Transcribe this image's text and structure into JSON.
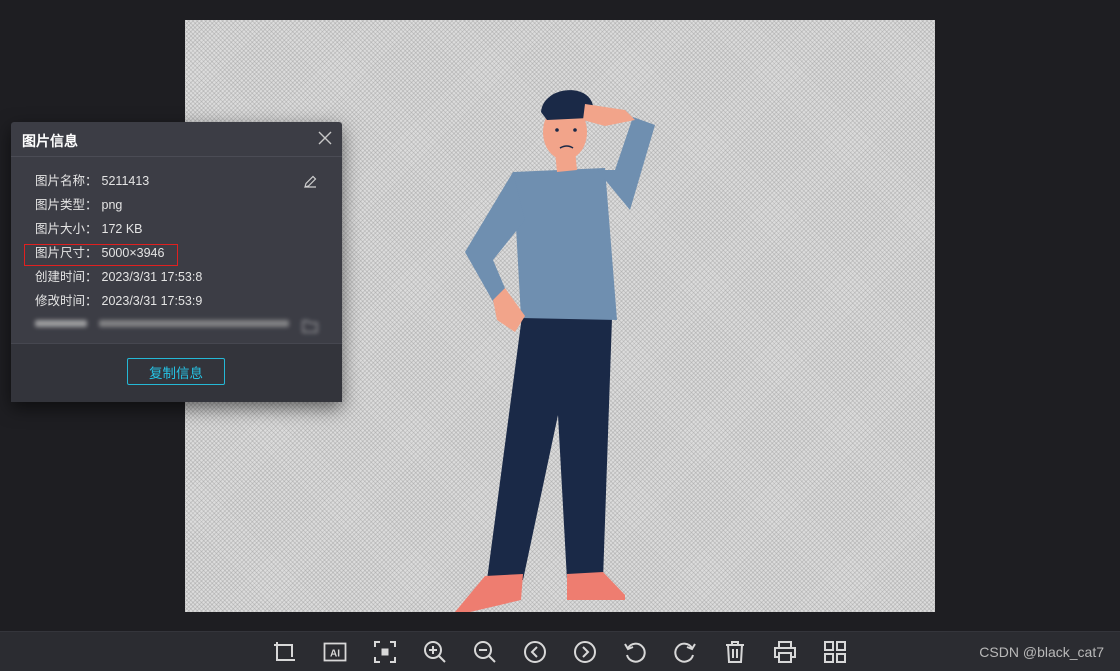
{
  "panel": {
    "title": "图片信息",
    "rows": [
      {
        "label": "图片名称：",
        "value": "5211413"
      },
      {
        "label": "图片类型：",
        "value": "png"
      },
      {
        "label": "图片大小：",
        "value": "172 KB"
      },
      {
        "label": "图片尺寸：",
        "value": "5000×3946"
      },
      {
        "label": "创建时间：",
        "value": "2023/3/31   17:53:8"
      },
      {
        "label": "修改时间：",
        "value": "2023/3/31   17:53:9"
      }
    ],
    "copy_button": "复制信息"
  },
  "toolbar": {
    "tools": [
      "crop-icon",
      "ai-icon",
      "fit-screen-icon",
      "zoom-in-icon",
      "zoom-out-icon",
      "previous-icon",
      "next-icon",
      "rotate-left-icon",
      "rotate-right-icon",
      "delete-icon",
      "print-icon",
      "grid-icon"
    ],
    "ai_text": "AI"
  },
  "watermark": "CSDN @black_cat7",
  "colors": {
    "accent": "#26c3e5",
    "highlight": "#e02020",
    "panel_bg": "#3c3d45"
  }
}
